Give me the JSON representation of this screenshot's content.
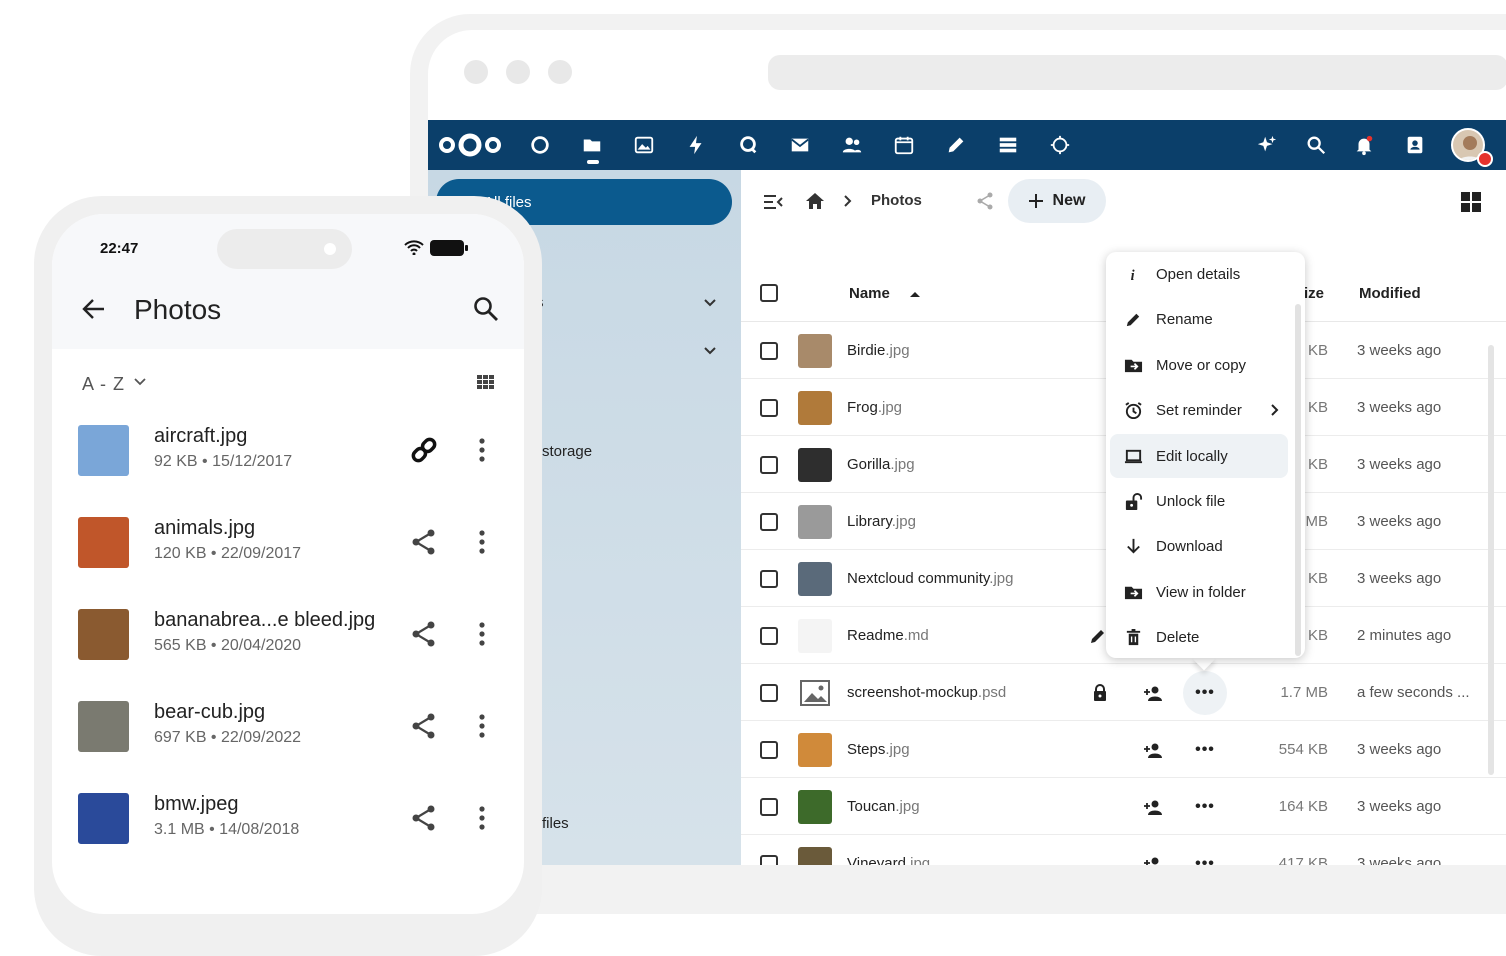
{
  "desktop": {
    "sidebar": {
      "active_item": "All files",
      "item_partial_1": "s",
      "item_partial_2": "storage",
      "item_partial_3": "files"
    },
    "breadcrumb": {
      "current": "Photos"
    },
    "new_button": "New",
    "table": {
      "col_name": "Name",
      "col_size_partial": "ize",
      "col_modified": "Modified",
      "rows": [
        {
          "base": "Birdie",
          "ext": ".jpg",
          "size": "KB",
          "modified": "3 weeks ago",
          "thumb": "#a88a6a"
        },
        {
          "base": "Frog",
          "ext": ".jpg",
          "size": "KB",
          "modified": "3 weeks ago",
          "thumb": "#b07a3a"
        },
        {
          "base": "Gorilla",
          "ext": ".jpg",
          "size": "KB",
          "modified": "3 weeks ago",
          "thumb": "#2e2e2e"
        },
        {
          "base": "Library",
          "ext": ".jpg",
          "size": "MB",
          "modified": "3 weeks ago",
          "thumb": "#9a9a9a"
        },
        {
          "base": "Nextcloud community",
          "ext": ".jpg",
          "size": "KB",
          "modified": "3 weeks ago",
          "thumb": "#5a6a7a"
        },
        {
          "base": "Readme",
          "ext": ".md",
          "size": "KB",
          "modified": "2 minutes ago",
          "thumb": "#f4f4f4"
        },
        {
          "base": "screenshot-mockup",
          "ext": ".psd",
          "size": "1.7 MB",
          "modified": "a few seconds ...",
          "thumb": "#e6e6e6"
        },
        {
          "base": "Steps",
          "ext": ".jpg",
          "size": "554 KB",
          "modified": "3 weeks ago",
          "thumb": "#d08a3a"
        },
        {
          "base": "Toucan",
          "ext": ".jpg",
          "size": "164 KB",
          "modified": "3 weeks ago",
          "thumb": "#3d6a2a"
        },
        {
          "base": "Vineyard",
          "ext": ".jpg",
          "size": "417 KB",
          "modified": "3 weeks ago",
          "thumb": "#6a5a3a"
        }
      ]
    },
    "more_label": "•••",
    "context_menu": [
      {
        "label": "Open details",
        "icon": "info-icon"
      },
      {
        "label": "Rename",
        "icon": "pencil-icon"
      },
      {
        "label": "Move or copy",
        "icon": "folder-move-icon"
      },
      {
        "label": "Set reminder",
        "icon": "alarm-icon"
      },
      {
        "label": "Edit locally",
        "icon": "laptop-icon"
      },
      {
        "label": "Unlock file",
        "icon": "unlock-icon"
      },
      {
        "label": "Download",
        "icon": "download-icon"
      },
      {
        "label": "View in folder",
        "icon": "folder-view-icon"
      },
      {
        "label": "Delete",
        "icon": "trash-icon"
      }
    ]
  },
  "phone": {
    "time": "22:47",
    "title": "Photos",
    "sort": "A - Z",
    "files": [
      {
        "name": "aircraft.jpg",
        "meta": "92 KB • 15/12/2017",
        "action": "link-icon",
        "thumb": "#7aa6d8"
      },
      {
        "name": "animals.jpg",
        "meta": "120 KB • 22/09/2017",
        "action": "share-icon",
        "thumb": "#c0562a"
      },
      {
        "name": "bananabrea...e bleed.jpg",
        "meta": "565 KB • 20/04/2020",
        "action": "share-icon",
        "thumb": "#8a5a30"
      },
      {
        "name": "bear-cub.jpg",
        "meta": "697 KB • 22/09/2022",
        "action": "share-icon",
        "thumb": "#7a7a70"
      },
      {
        "name": "bmw.jpeg",
        "meta": "3.1 MB • 14/08/2018",
        "action": "share-icon",
        "thumb": "#2a4a9a"
      }
    ]
  },
  "colors": {
    "header": "#0b3f6a",
    "nav_active": "#0b5a8e"
  }
}
